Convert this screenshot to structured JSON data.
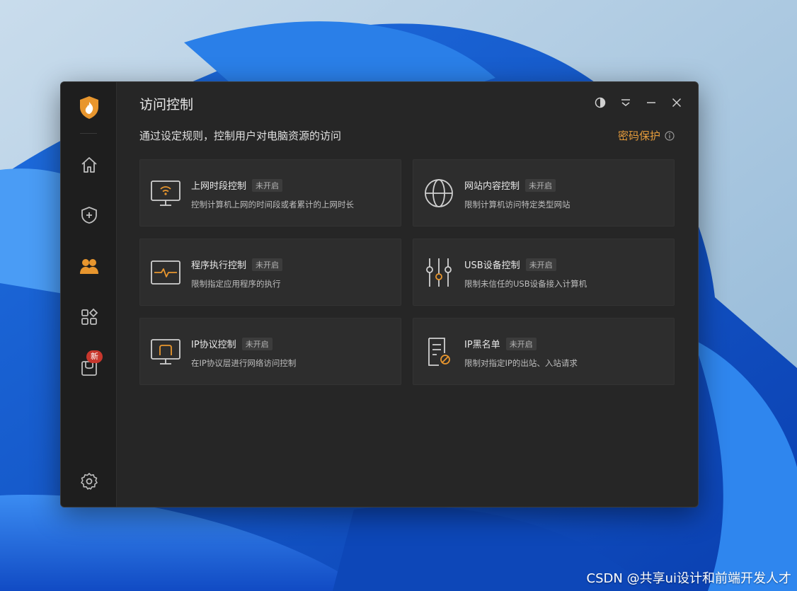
{
  "window": {
    "title": "访问控制",
    "subtitle": "通过设定规则，控制用户对电脑资源的访问",
    "password_protect": "密码保护"
  },
  "sidebar": {
    "items": [
      {
        "name": "home",
        "icon": "home-icon"
      },
      {
        "name": "protection",
        "icon": "shield-plus-icon"
      },
      {
        "name": "access-control",
        "icon": "users-icon",
        "active": true
      },
      {
        "name": "apps",
        "icon": "apps-grid-icon"
      },
      {
        "name": "toolbox",
        "icon": "box-icon",
        "badge": "新"
      }
    ],
    "settings_icon": "gear-icon"
  },
  "cards": [
    {
      "title": "上网时段控制",
      "status": "未开启",
      "desc": "控制计算机上网的时间段或者累计的上网时长",
      "icon": "wifi-monitor-icon"
    },
    {
      "title": "网站内容控制",
      "status": "未开启",
      "desc": "限制计算机访问特定类型网站",
      "icon": "globe-icon"
    },
    {
      "title": "程序执行控制",
      "status": "未开启",
      "desc": "限制指定应用程序的执行",
      "icon": "pulse-window-icon"
    },
    {
      "title": "USB设备控制",
      "status": "未开启",
      "desc": "限制未信任的USB设备接入计算机",
      "icon": "sliders-icon"
    },
    {
      "title": "IP协议控制",
      "status": "未开启",
      "desc": "在IP协议层进行网络访问控制",
      "icon": "monitor-network-icon"
    },
    {
      "title": "IP黑名单",
      "status": "未开启",
      "desc": "限制对指定IP的出站、入站请求",
      "icon": "document-block-icon"
    }
  ],
  "colors": {
    "accent": "#e59b3b",
    "window_bg": "#262626",
    "card_bg": "#2d2d2d",
    "badge": "#c8372d"
  },
  "watermark": "CSDN @共享ui设计和前端开发人才"
}
